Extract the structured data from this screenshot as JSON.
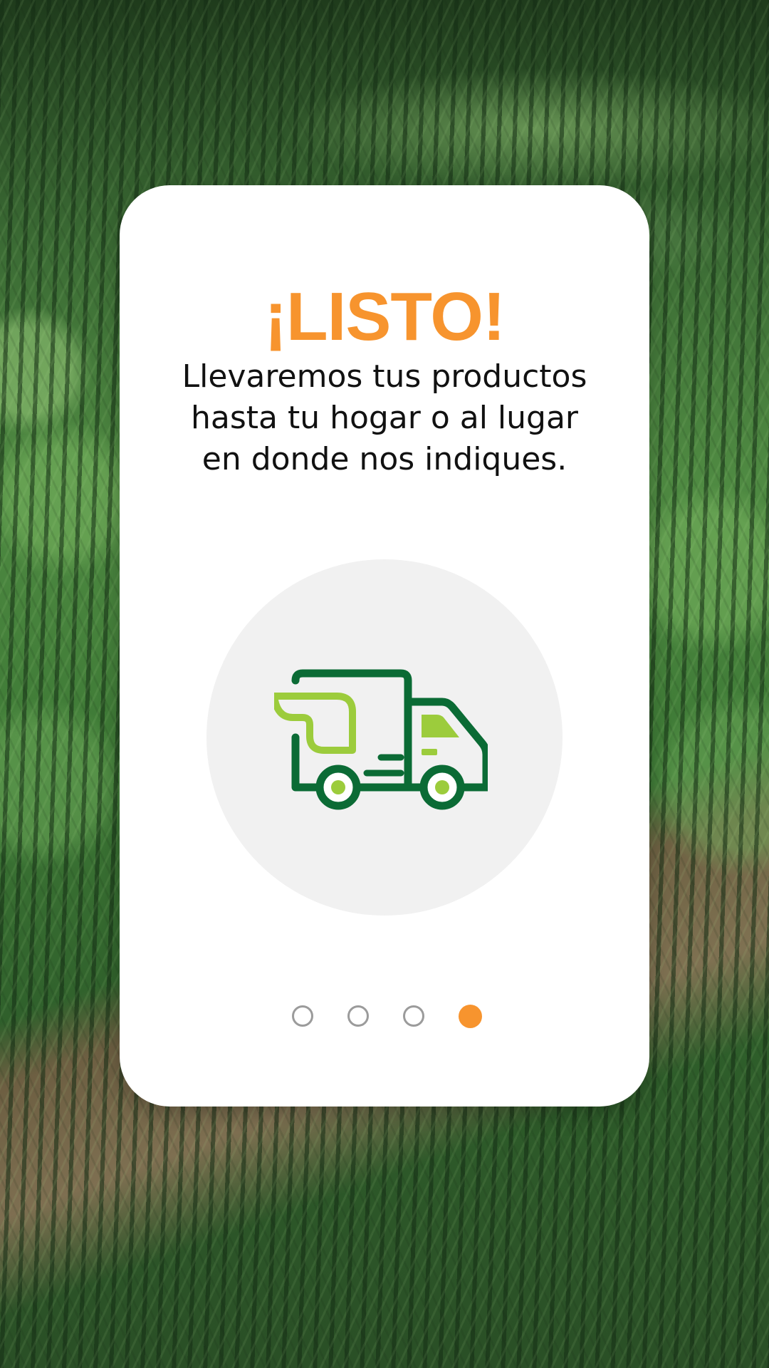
{
  "onboarding": {
    "title": "¡LISTO!",
    "message": "Llevaremos tus productos\nhasta tu hogar o al lugar\nen donde nos indiques.",
    "illustration_icon": "delivery-truck-icon",
    "pagination": {
      "total": 4,
      "current": 4
    }
  },
  "colors": {
    "accent": "#f7942e",
    "truck_dark_green": "#0b6b35",
    "truck_light_green": "#9ccc3c",
    "circle_bg": "#f1f1f1",
    "inactive_dot": "#9b9b9b"
  }
}
